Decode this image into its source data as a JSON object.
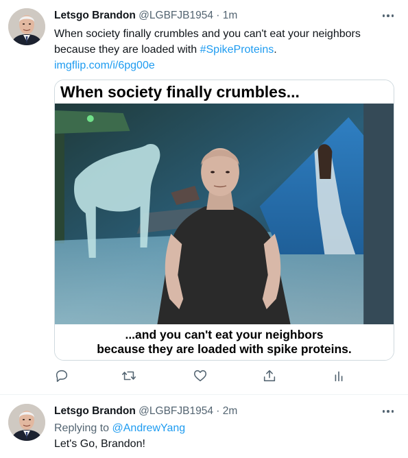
{
  "colors": {
    "accent": "#1d9bf0",
    "secondary_text": "#536471",
    "primary_text": "#0f1419",
    "divider": "#eff3f4"
  },
  "tweets": [
    {
      "author_name": "Letsgo Brandon",
      "handle": "@LGBFJB1954",
      "separator": "·",
      "time": "1m",
      "text_before": "When society finally crumbles and you can't eat your neighbors because they are loaded with ",
      "hashtag": "#SpikeProteins",
      "text_after": ".",
      "link": "imgflip.com/i/6pg00e",
      "media": {
        "top_caption": "When society finally crumbles...",
        "bottom_caption_line1": "...and you can't eat your neighbors",
        "bottom_caption_line2": "because they are loaded with spike proteins."
      },
      "actions": [
        "reply-icon",
        "retweet-icon",
        "like-icon",
        "share-icon",
        "analytics-icon"
      ]
    },
    {
      "author_name": "Letsgo Brandon",
      "handle": "@LGBFJB1954",
      "separator": "·",
      "time": "2m",
      "replying_prefix": "Replying to ",
      "replying_handle": "@AndrewYang",
      "text": "Let's Go, Brandon!"
    }
  ]
}
